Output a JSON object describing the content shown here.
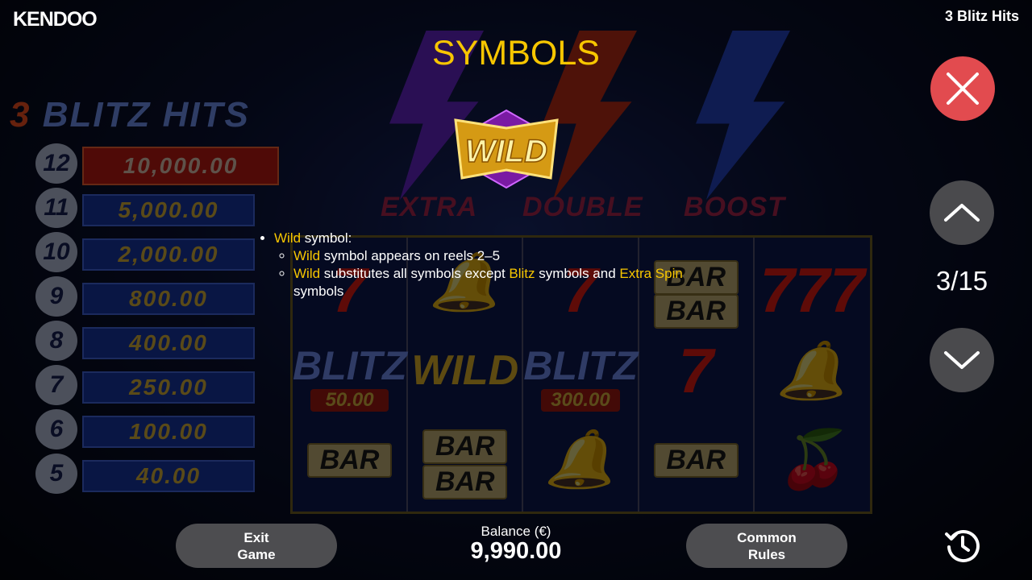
{
  "header": {
    "brand": "KENDOO",
    "game_title": "3 Blitz Hits"
  },
  "page": {
    "heading": "SYMBOLS",
    "symbol_badge": "WILD",
    "rules": {
      "main": {
        "highlight": "Wild",
        "text": " symbol:"
      },
      "sub": [
        {
          "parts": [
            {
              "t": "Wild",
              "hl": true
            },
            {
              "t": " symbol appears on reels 2–5",
              "hl": false
            }
          ]
        },
        {
          "parts": [
            {
              "t": "Wild",
              "hl": true
            },
            {
              "t": " substitutes all symbols except ",
              "hl": false
            },
            {
              "t": "Blitz",
              "hl": true
            },
            {
              "t": " symbols and ",
              "hl": false
            },
            {
              "t": "Extra Spin",
              "hl": true
            },
            {
              "t": " symbols",
              "hl": false
            }
          ]
        }
      ]
    }
  },
  "navigation": {
    "current_page": 3,
    "total_pages": 15,
    "counter_text": "3/15"
  },
  "footer": {
    "exit_button": {
      "line1": "Exit",
      "line2": "Game"
    },
    "balance_label": "Balance (€)",
    "balance_value": "9,990.00",
    "rules_button": {
      "line1": "Common",
      "line2": "Rules"
    }
  },
  "background": {
    "logo_text": {
      "number": "3",
      "word": "BLITZ HITS"
    },
    "feature_labels": [
      "EXTRA",
      "DOUBLE",
      "BOOST"
    ],
    "paytable": [
      {
        "count": "12",
        "amount": "10,000.00"
      },
      {
        "count": "11",
        "amount": "5,000.00"
      },
      {
        "count": "10",
        "amount": "2,000.00"
      },
      {
        "count": "9",
        "amount": "800.00"
      },
      {
        "count": "8",
        "amount": "400.00"
      },
      {
        "count": "7",
        "amount": "250.00"
      },
      {
        "count": "6",
        "amount": "100.00"
      },
      {
        "count": "5",
        "amount": "40.00"
      }
    ],
    "reel_texts": {
      "bar": "BAR",
      "blitz": "BLITZ",
      "wild": "WILD",
      "blitz_amount_1": "50.00",
      "blitz_amount_2": "300.00",
      "seven": "7",
      "seven_triple": "777"
    }
  },
  "colors": {
    "highlight": "#f7c600",
    "close_button": "#e24b4f",
    "nav_button": "#4a4a4d",
    "pill_button": "#4d4d50"
  },
  "icons": [
    "close-icon",
    "chevron-up-icon",
    "chevron-down-icon",
    "history-icon",
    "wild-symbol-icon"
  ]
}
